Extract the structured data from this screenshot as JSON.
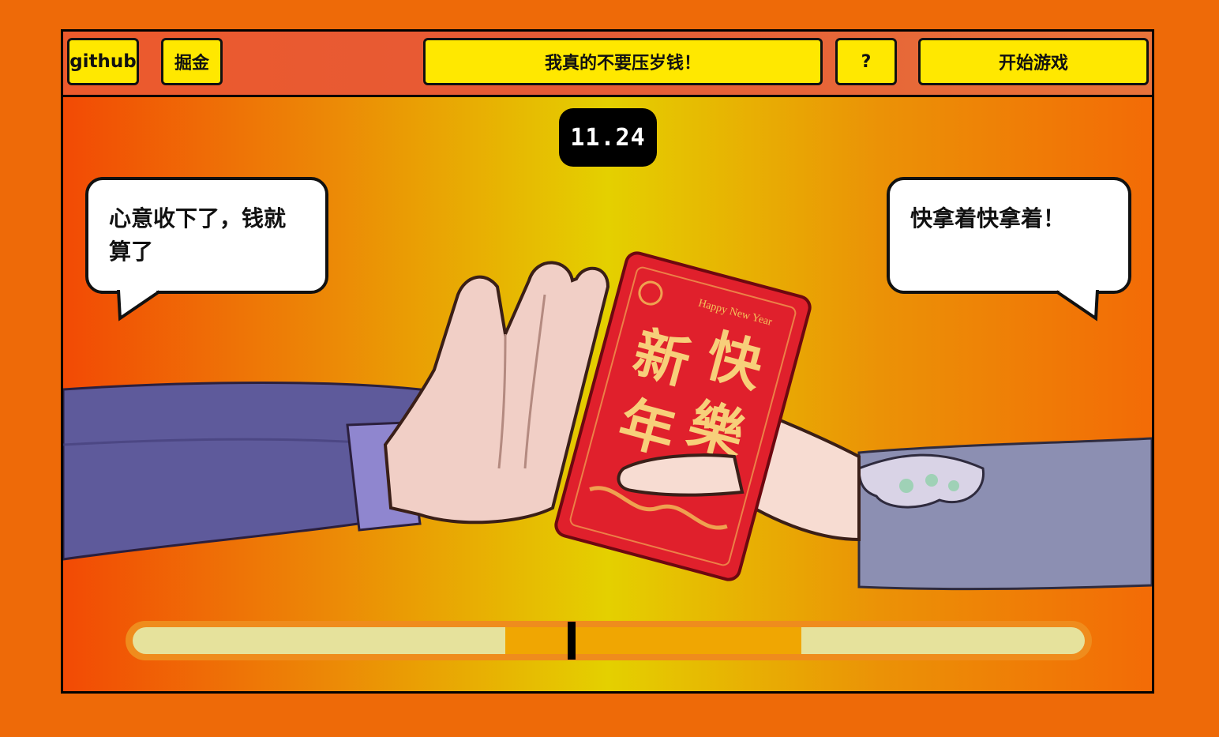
{
  "header": {
    "github_label": "github",
    "juejin_label": "掘金",
    "mode_label": "我真的不要压岁钱！",
    "help_label": "?",
    "start_label": "开始游戏"
  },
  "game": {
    "timer": "11.24",
    "left_speech": "心意收下了，钱就算了",
    "right_speech": "快拿着快拿着！",
    "envelope_text": [
      "新",
      "快",
      "年",
      "樂"
    ],
    "envelope_caption": "Happy New Year",
    "meter": {
      "target_zone": [
        0.391,
        0.7025
      ],
      "needle_position": 0.461
    }
  },
  "colors": {
    "page_background": "#ee6a08",
    "button_yellow": "#ffe800",
    "envelope_red": "#e0202c",
    "envelope_gold": "#f3c25a",
    "meter_zone": "#f0a602",
    "meter_track": "#e6e29c"
  }
}
